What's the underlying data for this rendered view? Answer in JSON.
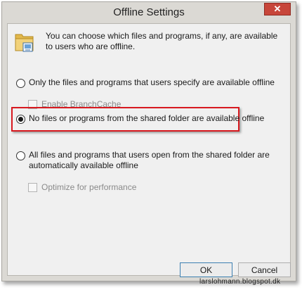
{
  "window": {
    "title": "Offline Settings",
    "close_glyph": "✕"
  },
  "intro": {
    "text": "You can choose which files and programs, if any, are available to users who are offline.",
    "icon": "folder-icon"
  },
  "options": {
    "only_specified": {
      "label": "Only the files and programs that users specify are available offline",
      "selected": false
    },
    "enable_branchcache": {
      "label": "Enable BranchCache",
      "checked": false,
      "enabled": false
    },
    "none_available": {
      "label": "No files or programs from the shared folder are available offline",
      "selected": true
    },
    "all_automatic": {
      "label": "All files and programs that users open from the shared folder are automatically available offline",
      "selected": false
    },
    "optimize_performance": {
      "label": "Optimize for performance",
      "checked": false,
      "enabled": false
    }
  },
  "buttons": {
    "ok_label": "OK",
    "cancel_label": "Cancel"
  },
  "watermark": {
    "text": "larslohmann.blogspot.dk"
  },
  "colors": {
    "highlight_border": "#d8191f",
    "close_button": "#c7463a",
    "dialog_bg": "#f0f0f0"
  }
}
